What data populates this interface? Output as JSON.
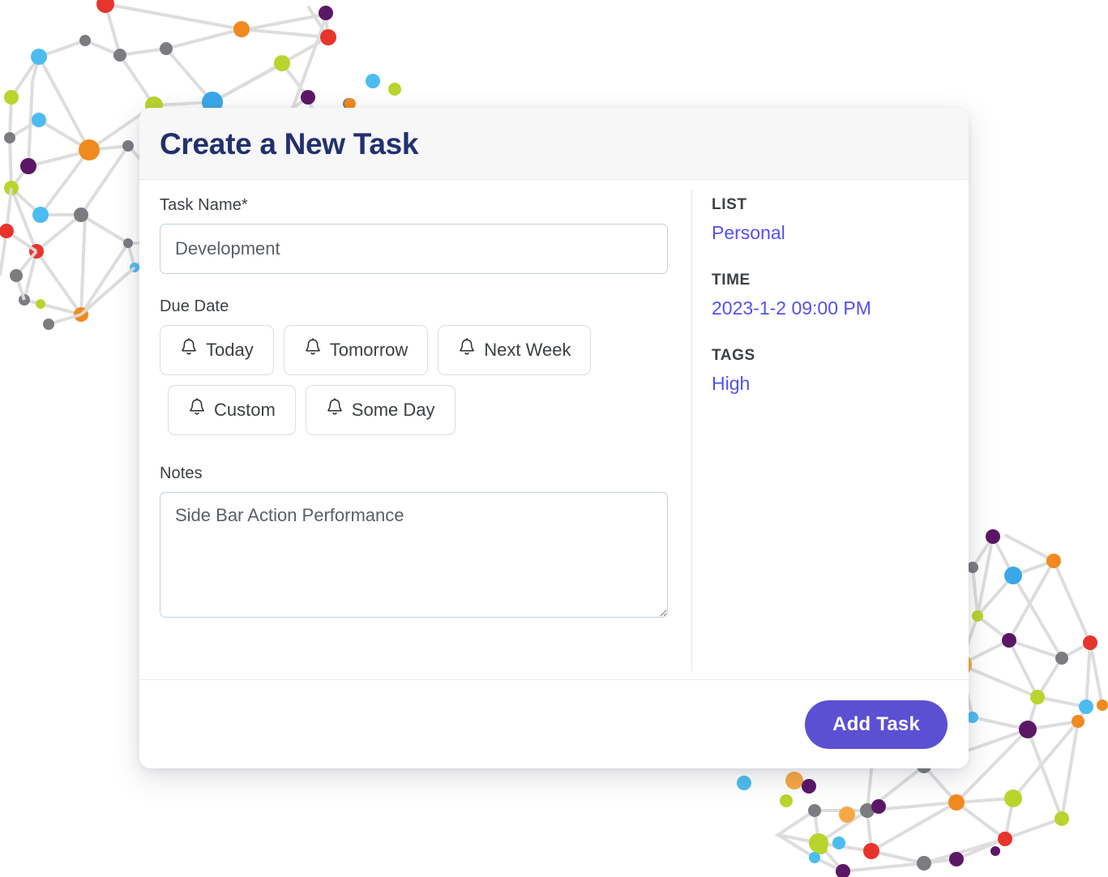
{
  "header": {
    "title": "Create a New Task"
  },
  "form": {
    "task_name": {
      "label": "Task Name*",
      "value": "Development",
      "placeholder": "Task Name"
    },
    "due_date": {
      "label": "Due Date",
      "options_row1": [
        {
          "label": "Today",
          "icon": "bell-icon"
        },
        {
          "label": "Tomorrow",
          "icon": "bell-icon"
        },
        {
          "label": "Next Week",
          "icon": "bell-icon"
        }
      ],
      "options_row2": [
        {
          "label": "Custom",
          "icon": "bell-icon"
        },
        {
          "label": "Some Day",
          "icon": "bell-icon"
        }
      ]
    },
    "notes": {
      "label": "Notes",
      "value": "Side Bar Action Performance",
      "placeholder": "Notes"
    }
  },
  "sidebar": {
    "list": {
      "label": "LIST",
      "value": "Personal"
    },
    "time": {
      "label": "TIME",
      "value": "2023-1-2 09:00 PM"
    },
    "tags": {
      "label": "TAGS",
      "value": "High"
    }
  },
  "footer": {
    "add_task_label": "Add Task"
  },
  "colors": {
    "title": "#22306e",
    "accent_link": "#5450ef",
    "primary_button": "#5b4fd4",
    "header_bg": "#f7f7f8",
    "input_border": "#c2cfdd",
    "chip_border": "#dcdddf"
  },
  "background": {
    "decoration": "network-mesh-spheres"
  }
}
